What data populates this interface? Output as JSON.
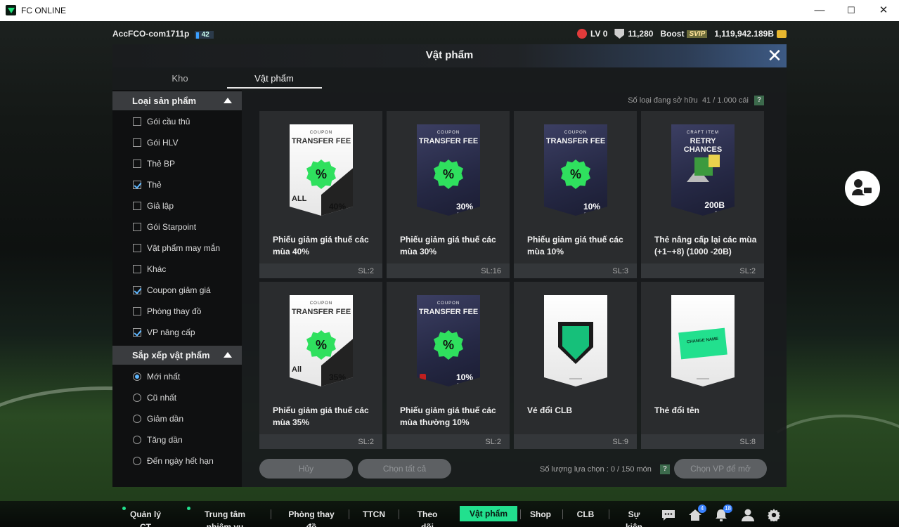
{
  "window": {
    "title": "FC ONLINE",
    "minimize": "—",
    "maximize": "☐",
    "close": "✕"
  },
  "hud": {
    "username": "AccFCO-com1711p",
    "user_level": "42",
    "lv_label": "LV 0",
    "shield_value": "11,280",
    "boost_label": "Boost",
    "svip_label": "SVIP",
    "currency": "1,119,942.189B"
  },
  "dialog": {
    "title": "Vật phẩm",
    "tabs": [
      "Kho",
      "Vật phẩm"
    ],
    "active_tab": "Vật phẩm",
    "owned_label": "Số loại đang sở hữu",
    "owned_value": "41 / 1.000 cái",
    "help": "?"
  },
  "filters": {
    "type_header": "Loại sản phẩm",
    "types": [
      {
        "label": "Gói cầu thủ",
        "checked": false
      },
      {
        "label": "Gói HLV",
        "checked": false
      },
      {
        "label": "Thẻ BP",
        "checked": false
      },
      {
        "label": "Thẻ",
        "checked": true
      },
      {
        "label": "Giả lập",
        "checked": false
      },
      {
        "label": "Gói Starpoint",
        "checked": false
      },
      {
        "label": "Vật phẩm may mắn",
        "checked": false
      },
      {
        "label": "Khác",
        "checked": false
      },
      {
        "label": "Coupon giảm giá",
        "checked": true
      },
      {
        "label": "Phòng thay đồ",
        "checked": false
      },
      {
        "label": "VP nâng cấp",
        "checked": true
      }
    ],
    "sort_header": "Sắp xếp vật phẩm",
    "sorts": [
      {
        "label": "Mới nhất",
        "selected": true
      },
      {
        "label": "Cũ nhất",
        "selected": false
      },
      {
        "label": "Giảm dần",
        "selected": false
      },
      {
        "label": "Tăng dần",
        "selected": false
      },
      {
        "label": "Đến ngày hết hạn",
        "selected": false
      }
    ]
  },
  "items": [
    {
      "name": "Phiếu giảm giá thuế các mùa 40%",
      "qty": "SL:2",
      "art": {
        "style": "white",
        "top": "COUPON",
        "title": "TRANSFER FEE",
        "value": "40%",
        "sub": "BONUS",
        "corner": "ALL"
      }
    },
    {
      "name": "Phiếu giảm giá thuế các mùa 30%",
      "qty": "SL:16",
      "art": {
        "style": "dark",
        "top": "COUPON",
        "title": "TRANSFER FEE",
        "value": "30%",
        "sub": "DISCOUNT"
      }
    },
    {
      "name": "Phiếu giảm giá thuế các mùa 10%",
      "qty": "SL:3",
      "art": {
        "style": "dark",
        "top": "COUPON",
        "title": "TRANSFER FEE",
        "value": "10%",
        "sub": "DISCOUNT"
      }
    },
    {
      "name": "Thẻ nâng cấp lại các mùa (+1~+8) (1000 -20B)",
      "qty": "SL:2",
      "art": {
        "style": "dark",
        "top": "CRAFT ITEM",
        "title": "RETRY CHANCES",
        "value": "200B",
        "sub": "MAX"
      }
    },
    {
      "name": "Phiếu giảm giá thuế các mùa 35%",
      "qty": "SL:2",
      "art": {
        "style": "white",
        "top": "COUPON",
        "title": "TRANSFER FEE",
        "value": "35%",
        "sub": "BONUS",
        "corner": "All"
      }
    },
    {
      "name": "Phiếu giảm giá thuế các mùa thường 10%",
      "qty": "SL:2",
      "art": {
        "style": "dark",
        "top": "COUPON",
        "title": "TRANSFER FEE",
        "value": "10%",
        "sub": "DISCOUNT"
      }
    },
    {
      "name": "Vé đổi CLB",
      "qty": "SL:9",
      "art": {
        "style": "white"
      }
    },
    {
      "name": "Thẻ đổi tên",
      "qty": "SL:8",
      "art": {
        "style": "white",
        "ticket": "CHANGE NAME"
      }
    }
  ],
  "footer": {
    "cancel": "Hủy",
    "select_all": "Chọn tất cả",
    "select_count": "Số lượng lựa chọn : 0 / 150 món",
    "open": "Chọn VP để mở"
  },
  "bottom_nav": {
    "items": [
      "Quản lý CT",
      "Trung tâm nhiệm vụ",
      "Phòng thay đồ",
      "TTCN",
      "Theo dõi",
      "Vật phẩm",
      "Shop",
      "CLB",
      "Sự kiện"
    ],
    "active": "Vật phẩm",
    "home_badge": "4",
    "bell_badge": "18"
  }
}
